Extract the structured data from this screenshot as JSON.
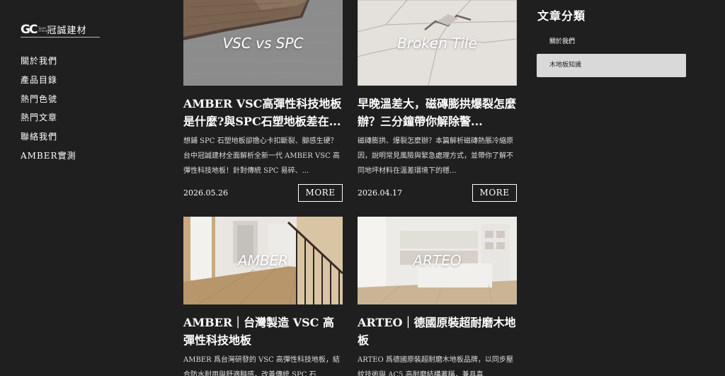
{
  "brand": {
    "mark": "GC",
    "small": "Guan Cheng",
    "name": "冠誠建材"
  },
  "nav": [
    {
      "label": "關於我們"
    },
    {
      "label": "產品目錄"
    },
    {
      "label": "熱門色號"
    },
    {
      "label": "熱門文章"
    },
    {
      "label": "聯絡我們"
    },
    {
      "label": "AMBER實測"
    }
  ],
  "posts": [
    {
      "image_text": "VSC vs SPC",
      "title": "AMBER VSC高彈性科技地板是什麼?與SPC石塑地板差在...",
      "excerpt": "想鋪 SPC 石塑地板卻擔心卡扣斷裂、腳感生硬？台中冠誠建材全面解析全新一代 AMBER VSC 高彈性科技地板！針對傳統 SPC 易碎、...",
      "date": "2026.05.26",
      "more": "MORE"
    },
    {
      "image_text": "Broken Tile",
      "title": "早晚溫差大，磁磚膨拱爆裂怎麼辦？三分鐘帶你解除警...",
      "excerpt": "磁磚膨拱、爆裂怎麼辦？本篇解析磁磚熱脹冷縮原因，說明常見風險與緊急處理方式，並帶你了解不同地坪材料在溫差環境下的穩...",
      "date": "2026.04.17",
      "more": "MORE"
    },
    {
      "image_text": "AMBER",
      "title": "AMBER｜台灣製造 VSC 高彈性科技地板",
      "excerpt": "AMBER 爲台灣研發的 VSC 高彈性科技地板，結合防水耐用與舒適腳感，改善傳統 SPC 石"
    },
    {
      "image_text": "ARTEO",
      "title": "ARTEO｜德國原裝超耐磨木地板",
      "excerpt": "ARTEO 爲德國原裝超耐磨木地板品牌，以同步壓紋技術與 AC5 高耐磨結構著稱，兼具真"
    }
  ],
  "categories": {
    "title": "文章分類",
    "items": [
      {
        "label": "關於我們",
        "active": false
      },
      {
        "label": "木地板知識",
        "active": true
      }
    ]
  }
}
